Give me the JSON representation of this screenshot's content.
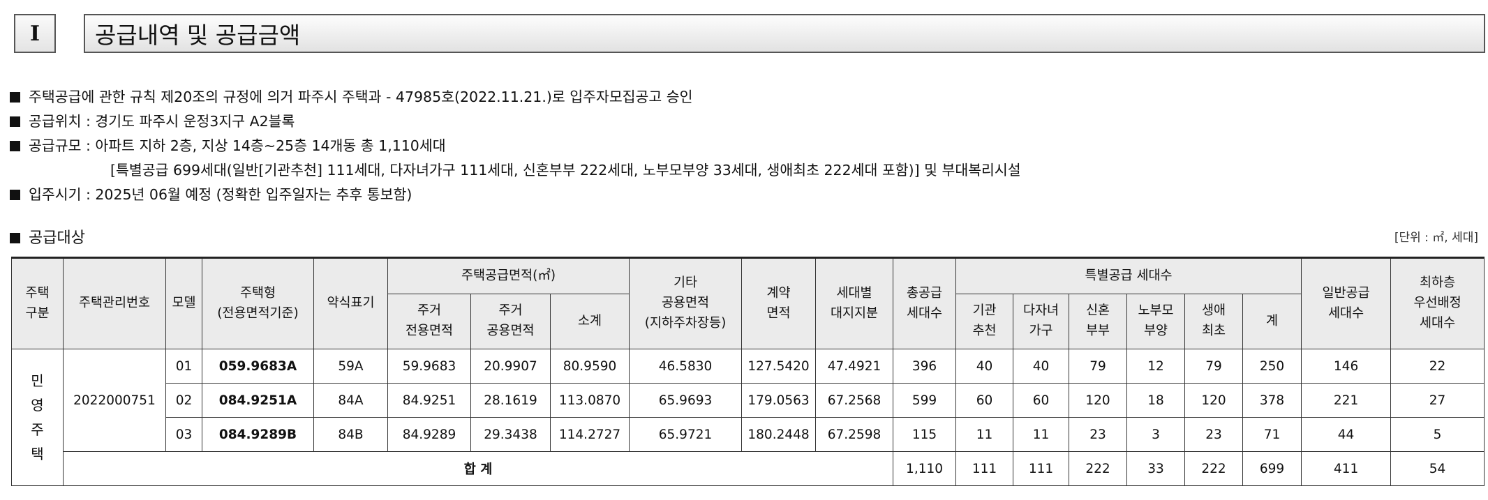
{
  "section": {
    "number": "I",
    "title": "공급내역 및 공급금액"
  },
  "bullets": [
    "주택공급에 관한 규칙 제20조의 규정에 의거 파주시 주택과 - 47985호(2022.11.21.)로 입주자모집공고 승인",
    "공급위치 : 경기도 파주시 운정3지구 A2블록",
    "공급규모 : 아파트 지하 2층, 지상 14층~25층 14개동 총 1,110세대",
    "[특별공급 699세대(일반[기관추천] 111세대, 다자녀가구 111세대, 신혼부부 222세대, 노부모부양 33세대, 생애최초 222세대 포함)] 및 부대복리시설",
    "입주시기 : 2025년 06월 예정 (정확한 입주일자는 추후 통보함)"
  ],
  "target_heading": "공급대상",
  "unit_note": "[단위 : ㎡, 세대]",
  "table": {
    "headers": {
      "house_type_category": "주택\n구분",
      "management_no": "주택관리번호",
      "model": "모델",
      "house_type": "주택형\n(전용면적기준)",
      "short_label": "약식표기",
      "supply_area_group": "주택공급면적(㎡)",
      "exclusive_area": "주거\n전용면적",
      "common_area": "주거\n공용면적",
      "subtotal": "소계",
      "other_common": "기타\n공용면적\n(지하주차장등)",
      "contract_area": "계약\n면적",
      "land_share": "세대별\n대지지분",
      "total_units": "총공급\n세대수",
      "special_group": "특별공급 세대수",
      "institution": "기관\n추천",
      "multi_child": "다자녀\n가구",
      "newlywed": "신혼\n부부",
      "elderly_parent": "노부모\n부양",
      "first_time": "생애\n최초",
      "special_sum": "계",
      "general_units": "일반공급\n세대수",
      "lowest_floor": "최하층\n우선배정\n세대수"
    },
    "category": "민\n영\n주\n택",
    "management_number": "2022000751",
    "rows": [
      {
        "model": "01",
        "type": "059.9683A",
        "short": "59A",
        "exclusive": "59.9683",
        "common": "20.9907",
        "subtotal": "80.9590",
        "other": "46.5830",
        "contract": "127.5420",
        "land": "47.4921",
        "total": "396",
        "institution": "40",
        "multi_child": "40",
        "newlywed": "79",
        "elderly": "12",
        "first_time": "79",
        "special_sum": "250",
        "general": "146",
        "lowest": "22"
      },
      {
        "model": "02",
        "type": "084.9251A",
        "short": "84A",
        "exclusive": "84.9251",
        "common": "28.1619",
        "subtotal": "113.0870",
        "other": "65.9693",
        "contract": "179.0563",
        "land": "67.2568",
        "total": "599",
        "institution": "60",
        "multi_child": "60",
        "newlywed": "120",
        "elderly": "18",
        "first_time": "120",
        "special_sum": "378",
        "general": "221",
        "lowest": "27"
      },
      {
        "model": "03",
        "type": "084.9289B",
        "short": "84B",
        "exclusive": "84.9289",
        "common": "29.3438",
        "subtotal": "114.2727",
        "other": "65.9721",
        "contract": "180.2448",
        "land": "67.2598",
        "total": "115",
        "institution": "11",
        "multi_child": "11",
        "newlywed": "23",
        "elderly": "3",
        "first_time": "23",
        "special_sum": "71",
        "general": "44",
        "lowest": "5"
      }
    ],
    "sum": {
      "label": "합 계",
      "total": "1,110",
      "institution": "111",
      "multi_child": "111",
      "newlywed": "222",
      "elderly": "33",
      "first_time": "222",
      "special_sum": "699",
      "general": "411",
      "lowest": "54"
    }
  }
}
